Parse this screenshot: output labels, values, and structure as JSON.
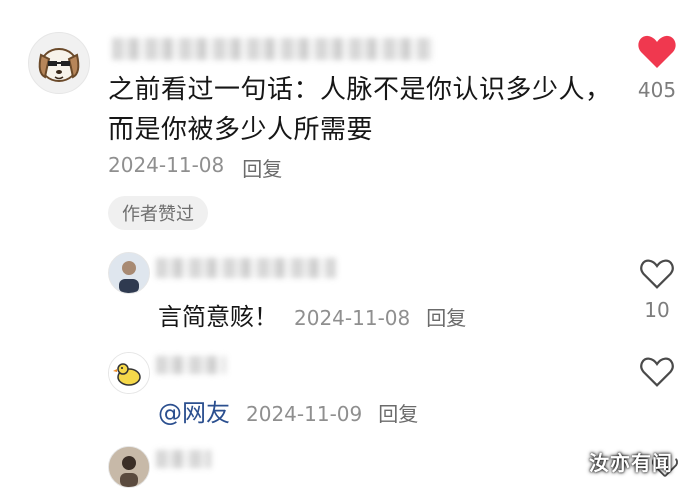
{
  "main_comment": {
    "text": "之前看过一句话：人脉不是你认识多少人，而是你被多少人所需要",
    "date": "2024-11-08",
    "reply_label": "回复",
    "author_badge": "作者赞过",
    "likes": "405",
    "liked": true
  },
  "replies": [
    {
      "text": "言简意赅！",
      "date": "2024-11-08",
      "reply_label": "回复",
      "likes": "10"
    },
    {
      "mention": "@网友",
      "date": "2024-11-09",
      "reply_label": "回复",
      "likes": ""
    },
    {
      "text": "",
      "date": "",
      "reply_label": "",
      "likes": ""
    }
  ],
  "watermark": "汝亦有闻",
  "colors": {
    "like_red": "#f0384f",
    "mention_blue": "#2b4f8f",
    "meta_gray": "#8f8f8f"
  },
  "icons": {
    "liked": "heart-filled-icon",
    "unliked": "heart-outline-icon"
  }
}
